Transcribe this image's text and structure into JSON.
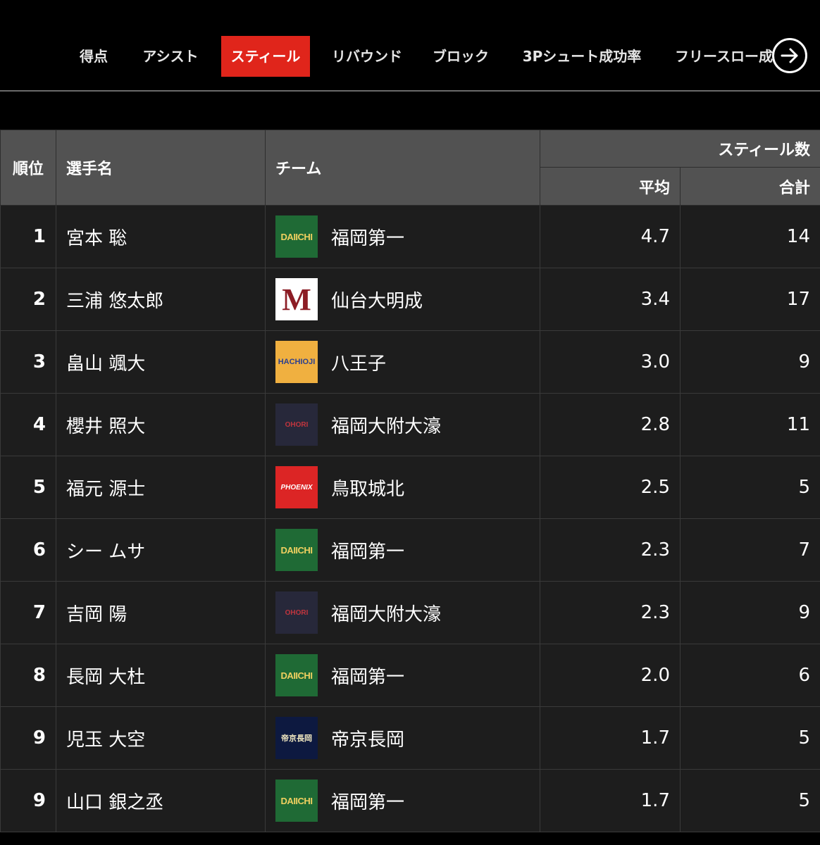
{
  "tabs": [
    {
      "label": "得点",
      "active": false
    },
    {
      "label": "アシスト",
      "active": false
    },
    {
      "label": "スティール",
      "active": true
    },
    {
      "label": "リバウンド",
      "active": false
    },
    {
      "label": "ブロック",
      "active": false
    },
    {
      "label": "3Pシュート成功率",
      "active": false
    },
    {
      "label": "フリースロー成功率",
      "active": false
    }
  ],
  "next_icon": "arrow-right-circle-icon",
  "accent_color": "#e0251b",
  "table": {
    "headers": {
      "rank": "順位",
      "player": "選手名",
      "team": "チーム",
      "stat_group": "スティール数",
      "average": "平均",
      "total": "合計"
    },
    "rows": [
      {
        "rank": "1",
        "player": "宮本 聡",
        "team": "福岡第一",
        "logo_text": "DAIICHI",
        "average": "4.7",
        "total": "14"
      },
      {
        "rank": "2",
        "player": "三浦 悠太郎",
        "team": "仙台大明成",
        "logo_text": "M",
        "average": "3.4",
        "total": "17"
      },
      {
        "rank": "3",
        "player": "畠山 颯大",
        "team": "八王子",
        "logo_text": "HACHIOJI",
        "average": "3.0",
        "total": "9"
      },
      {
        "rank": "4",
        "player": "櫻井 照大",
        "team": "福岡大附大濠",
        "logo_text": "OHORI",
        "average": "2.8",
        "total": "11"
      },
      {
        "rank": "5",
        "player": "福元 源士",
        "team": "鳥取城北",
        "logo_text": "PHOENIX",
        "average": "2.5",
        "total": "5"
      },
      {
        "rank": "6",
        "player": "シー ムサ",
        "team": "福岡第一",
        "logo_text": "DAIICHI",
        "average": "2.3",
        "total": "7"
      },
      {
        "rank": "7",
        "player": "吉岡 陽",
        "team": "福岡大附大濠",
        "logo_text": "OHORI",
        "average": "2.3",
        "total": "9"
      },
      {
        "rank": "8",
        "player": "長岡 大杜",
        "team": "福岡第一",
        "logo_text": "DAIICHI",
        "average": "2.0",
        "total": "6"
      },
      {
        "rank": "9",
        "player": "児玉 大空",
        "team": "帝京長岡",
        "logo_text": "帝京長岡",
        "average": "1.7",
        "total": "5"
      },
      {
        "rank": "9",
        "player": "山口 銀之丞",
        "team": "福岡第一",
        "logo_text": "DAIICHI",
        "average": "1.7",
        "total": "5"
      }
    ]
  }
}
